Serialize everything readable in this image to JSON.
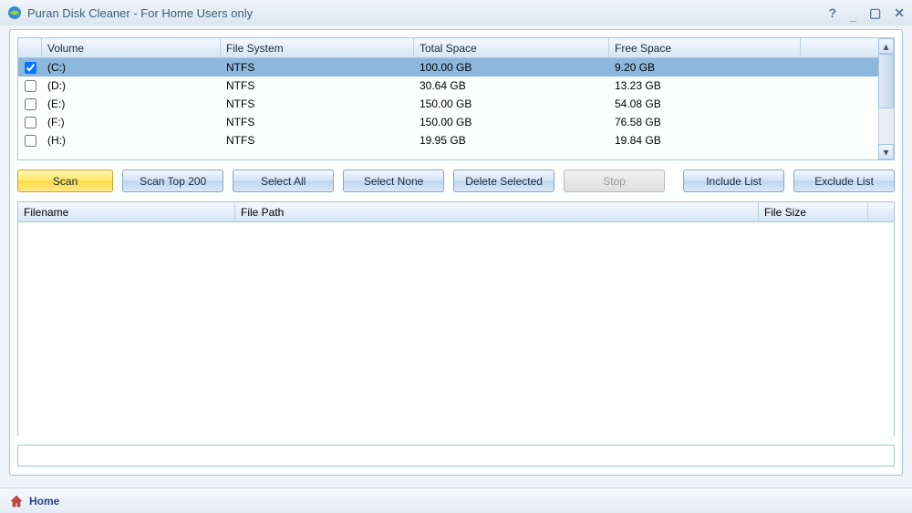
{
  "window": {
    "title": "Puran Disk Cleaner - For Home Users only"
  },
  "volume_table": {
    "headers": {
      "volume": "Volume",
      "filesystem": "File System",
      "total": "Total Space",
      "free": "Free Space"
    },
    "rows": [
      {
        "checked": true,
        "volume": "(C:)",
        "fs": "NTFS",
        "total": "100.00 GB",
        "free": "9.20 GB",
        "selected": true
      },
      {
        "checked": false,
        "volume": "(D:)",
        "fs": "NTFS",
        "total": "30.64 GB",
        "free": "13.23 GB",
        "selected": false
      },
      {
        "checked": false,
        "volume": "(E:)",
        "fs": "NTFS",
        "total": "150.00 GB",
        "free": "54.08 GB",
        "selected": false
      },
      {
        "checked": false,
        "volume": "(F:)",
        "fs": "NTFS",
        "total": "150.00 GB",
        "free": "76.58 GB",
        "selected": false
      },
      {
        "checked": false,
        "volume": "(H:)",
        "fs": "NTFS",
        "total": "19.95 GB",
        "free": "19.84 GB",
        "selected": false
      }
    ]
  },
  "buttons": {
    "scan": "Scan",
    "scan_top": "Scan Top 200",
    "select_all": "Select All",
    "select_none": "Select None",
    "delete_selected": "Delete Selected",
    "stop": "Stop",
    "include_list": "Include List",
    "exclude_list": "Exclude List"
  },
  "results_table": {
    "headers": {
      "filename": "Filename",
      "filepath": "File Path",
      "filesize": "File Size"
    }
  },
  "footer": {
    "home": "Home"
  }
}
